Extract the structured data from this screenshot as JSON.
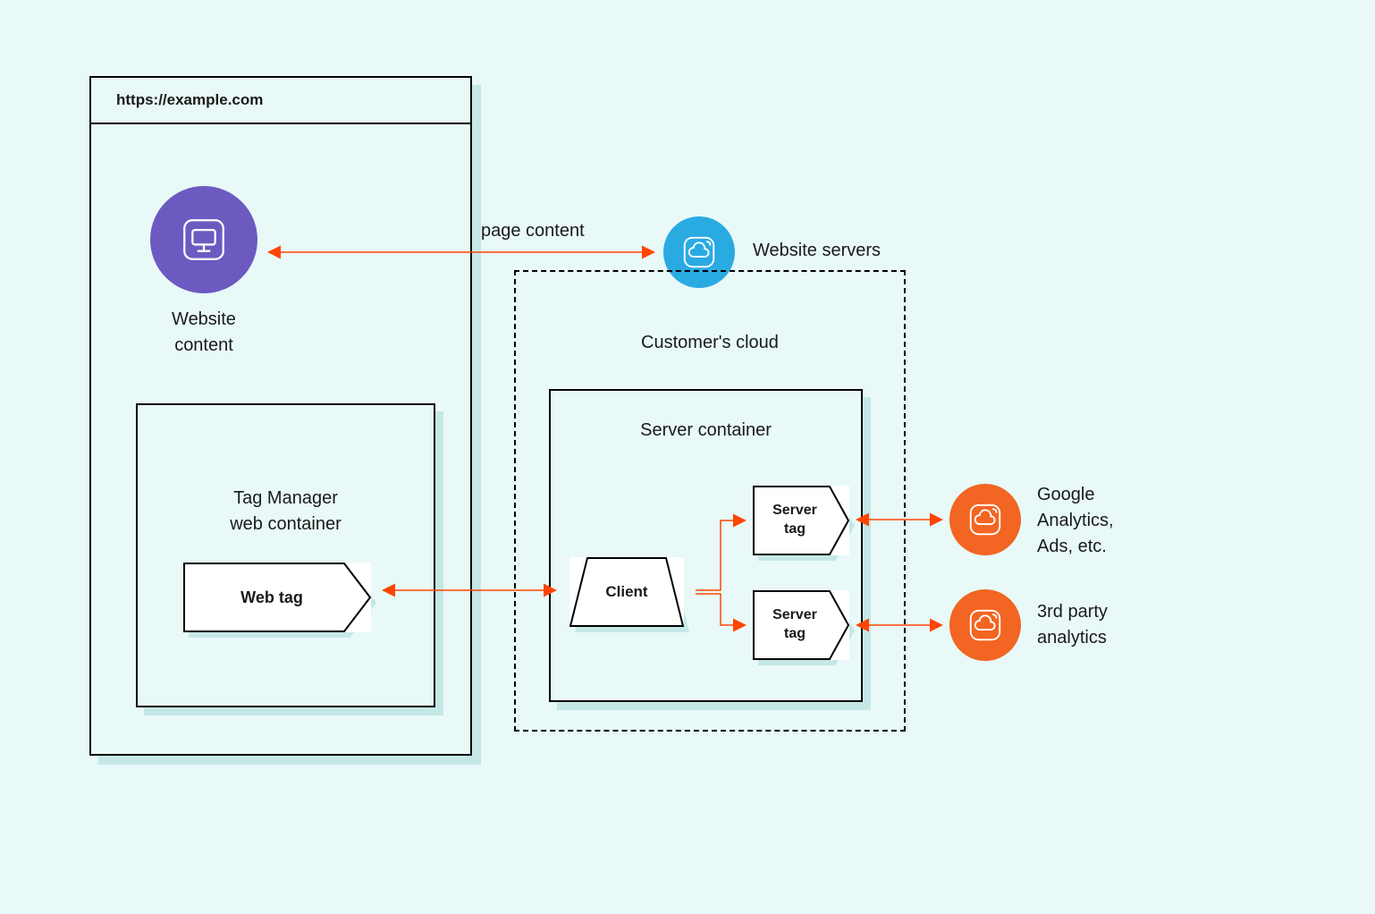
{
  "browser": {
    "url": "https://example.com"
  },
  "website_content": {
    "label": "Website\ncontent"
  },
  "page_content_label": "page content",
  "website_servers_label": "Website servers",
  "cloud": {
    "label": "Customer's cloud"
  },
  "web_container": {
    "label": "Tag Manager\nweb container",
    "web_tag": "Web tag"
  },
  "server_container": {
    "label": "Server container",
    "client": "Client",
    "server_tag_1": "Server\ntag",
    "server_tag_2": "Server\ntag"
  },
  "destinations": {
    "google": "Google\nAnalytics,\nAds, etc.",
    "third_party": "3rd party\nanalytics"
  },
  "colors": {
    "purple": "#6d5ac1",
    "blue": "#29abe2",
    "orange": "#f26522",
    "arrow": "#ff4500",
    "bg": "#e8f9f8",
    "shadow": "#c5e8e6"
  }
}
